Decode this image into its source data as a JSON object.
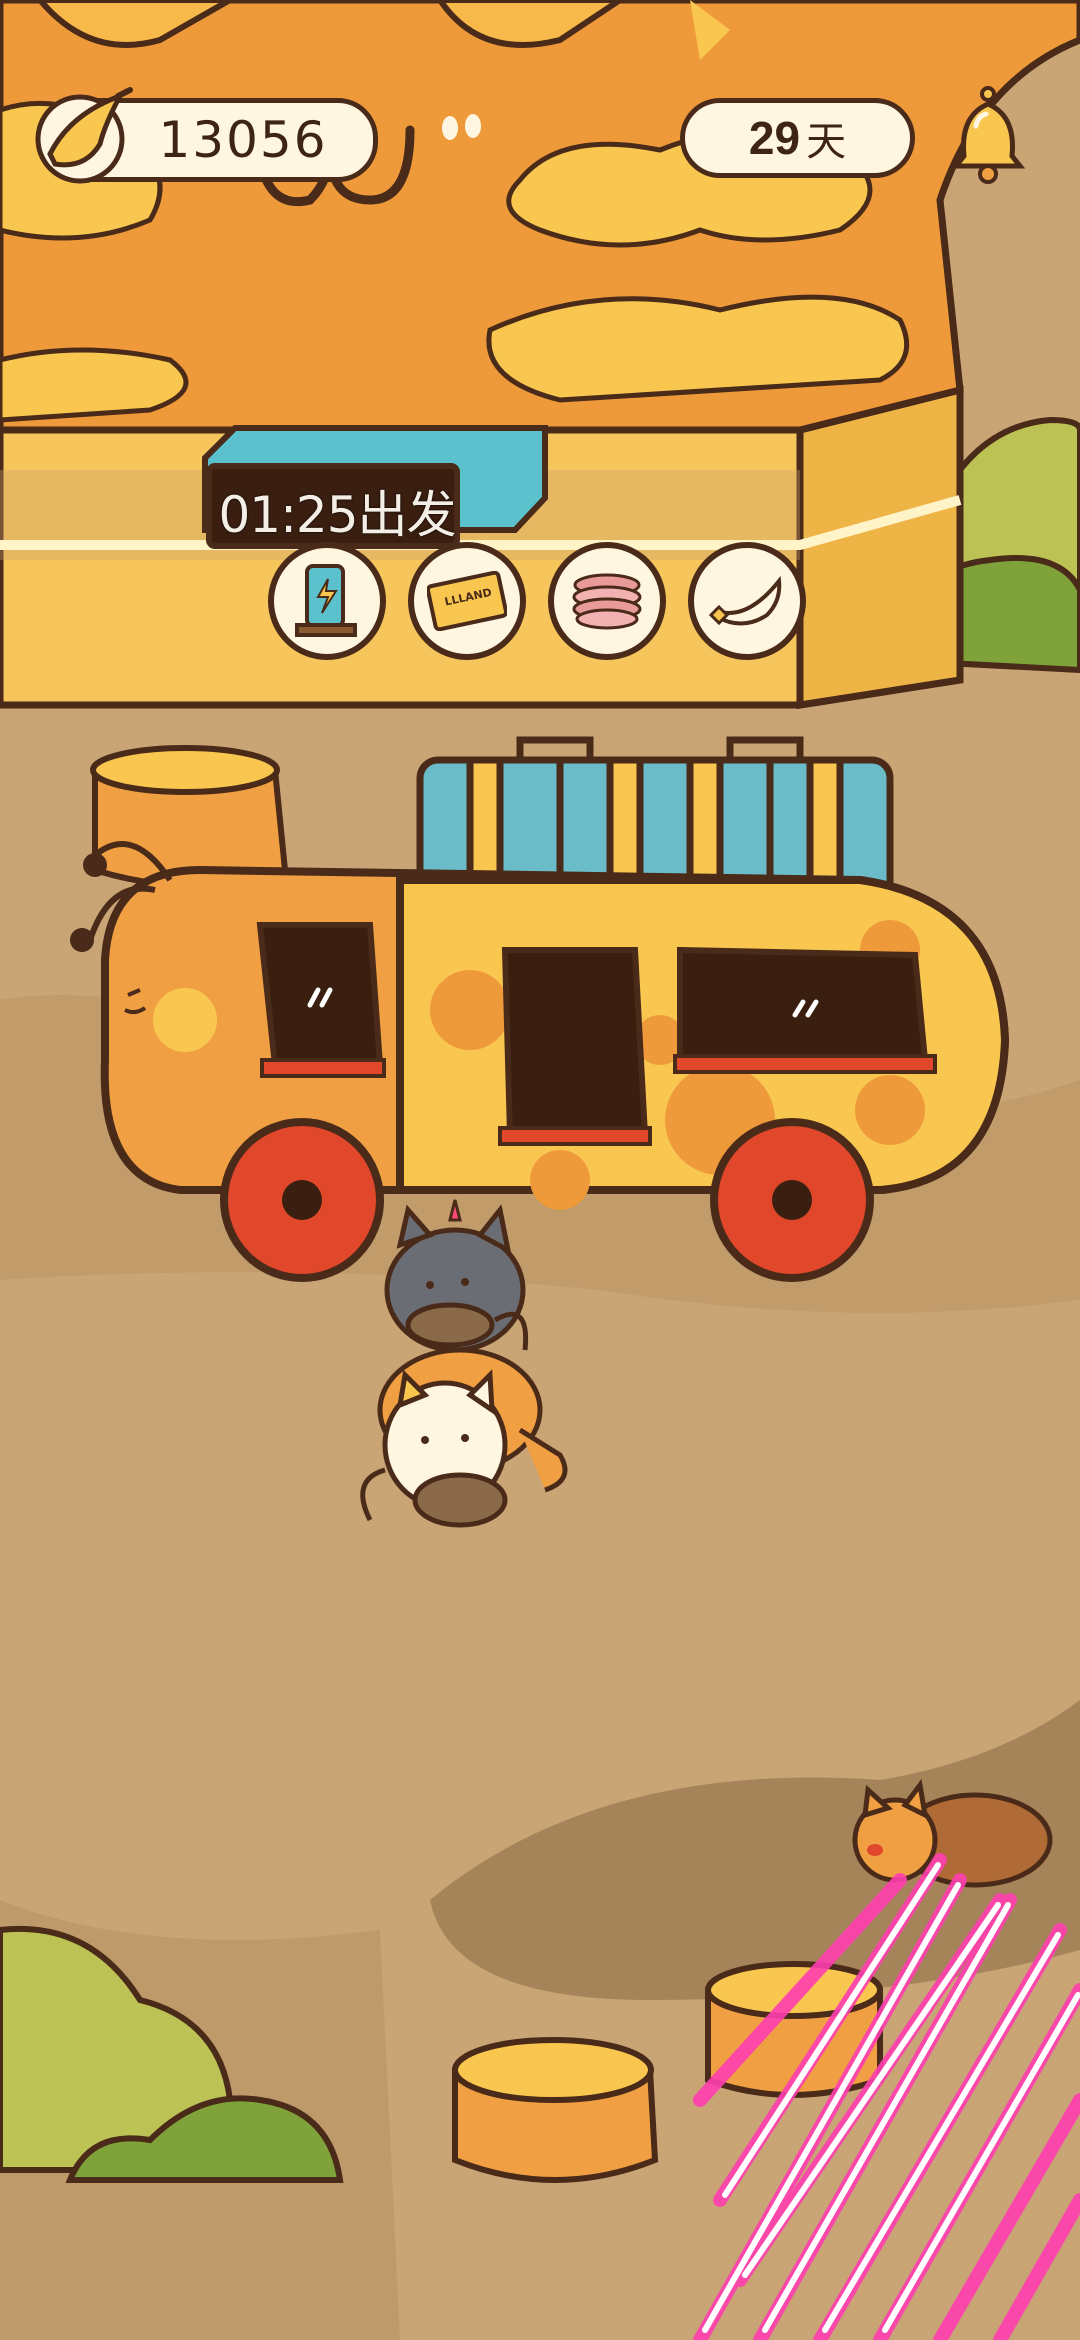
{
  "hud": {
    "coins": "13056",
    "days_value": "29",
    "days_unit": "天",
    "coin_icon": "banana-icon",
    "notification_icon": "bell-icon"
  },
  "departure": {
    "label": "01:25出发"
  },
  "items": [
    {
      "name": "charging-station-icon"
    },
    {
      "name": "ticket-icon",
      "text": "LLLAND"
    },
    {
      "name": "macaron-icon"
    },
    {
      "name": "horn-icon"
    }
  ],
  "colors": {
    "ground": "#c9a474",
    "building_orange": "#ef9a3a",
    "building_yellow": "#f9c74f",
    "outline": "#4a2a18",
    "bus_orange": "#f0a043",
    "wheel_red": "#e1472b",
    "luggage_blue": "#6bbcc9",
    "bush_green": "#a9b54a"
  }
}
